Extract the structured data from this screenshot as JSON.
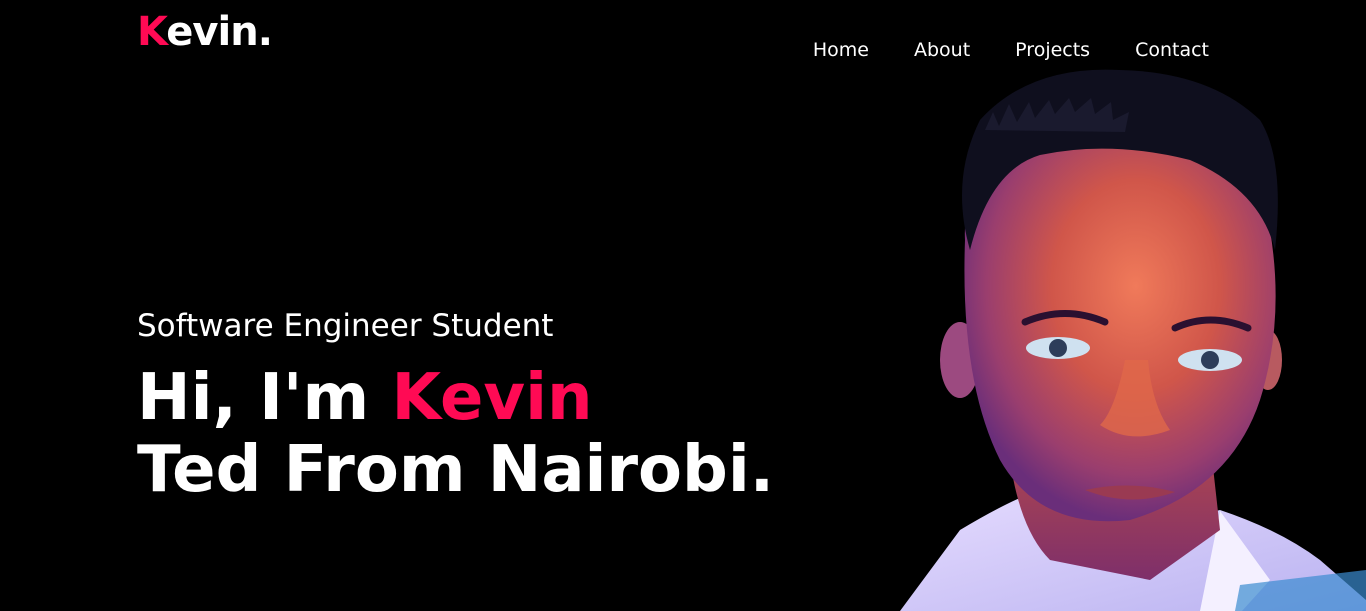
{
  "logo": {
    "first_letter": "K",
    "rest": "evin.",
    "accent_color": "#ff0a54"
  },
  "nav": {
    "items": [
      {
        "label": "Home"
      },
      {
        "label": "About"
      },
      {
        "label": "Projects"
      },
      {
        "label": "Contact"
      }
    ]
  },
  "hero": {
    "subtitle": "Software Engineer Student",
    "greeting": "Hi, I'm ",
    "name": "Kevin",
    "line2": "Ted From Nairobi.",
    "portrait_icon": "portrait-photo"
  },
  "colors": {
    "background": "#000000",
    "text": "#ffffff",
    "accent": "#ff0a54"
  }
}
